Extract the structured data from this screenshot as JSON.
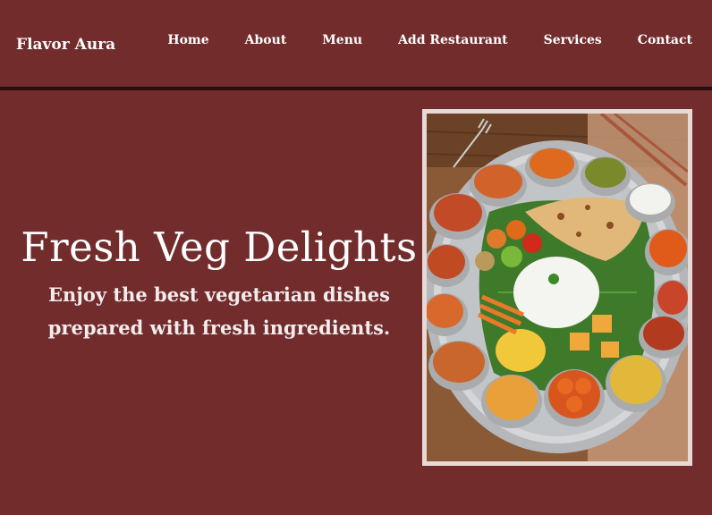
{
  "brand": "Flavor Aura",
  "nav": {
    "items": [
      "Home",
      "About",
      "Menu",
      "Add Restaurant",
      "Services",
      "Contact"
    ]
  },
  "hero": {
    "title": "Fresh Veg Delights",
    "subtitle_line1": "Enjoy the best vegetarian dishes",
    "subtitle_line2": "prepared with fresh ingredients."
  },
  "colors": {
    "background": "#722c2c",
    "nav_border": "#2a0d0d",
    "image_frame": "#e7d9d6"
  }
}
